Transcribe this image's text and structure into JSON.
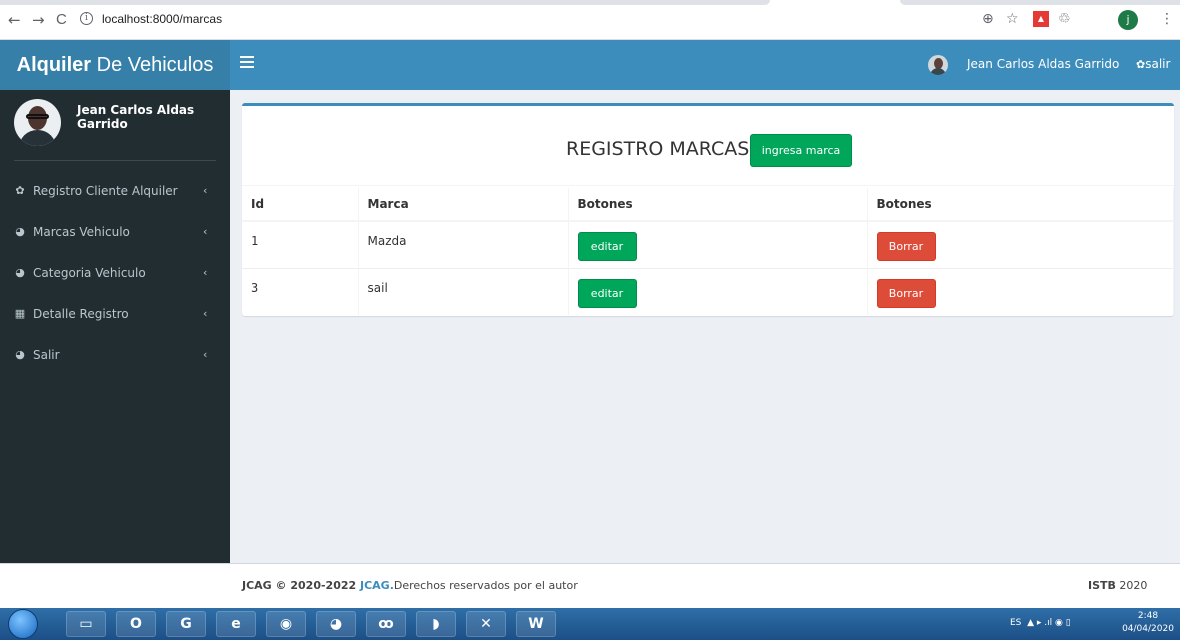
{
  "browser": {
    "url": "localhost:8000/marcas",
    "back_icon": "←",
    "forward_icon": "→",
    "reload_icon": "C",
    "info_icon": "i",
    "zoom_icon": "⊕",
    "star_icon": "☆",
    "ext_icon": "▲",
    "ext2_icon": "♲",
    "profile_initial": "j",
    "menu_icon": "⋮"
  },
  "header": {
    "logo_bold": "Alquiler",
    "logo_rest": " De Vehiculos",
    "user_name": "Jean Carlos Aldas Garrido",
    "logout_label": "salir",
    "logout_icon": "✿"
  },
  "sidebar": {
    "user_name": "Jean Carlos Aldas Garrido",
    "items": [
      {
        "icon": "✿",
        "label": "Registro Cliente Alquiler",
        "chevron": "‹"
      },
      {
        "icon": "◕",
        "label": "Marcas Vehiculo",
        "chevron": "‹"
      },
      {
        "icon": "◕",
        "label": "Categoria Vehiculo",
        "chevron": "‹"
      },
      {
        "icon": "▦",
        "label": "Detalle Registro",
        "chevron": "‹"
      },
      {
        "icon": "◕",
        "label": "Salir",
        "chevron": "‹"
      }
    ]
  },
  "main": {
    "title": "REGISTRO MARCAS",
    "add_button": "ingresa marca",
    "columns": [
      "Id",
      "Marca",
      "Botones",
      "Botones"
    ],
    "rows": [
      {
        "id": "1",
        "marca": "Mazda",
        "edit": "editar",
        "delete": "Borrar"
      },
      {
        "id": "3",
        "marca": "sail",
        "edit": "editar",
        "delete": "Borrar"
      }
    ]
  },
  "footer": {
    "left_prefix": "JCAG © 2020-2022 ",
    "left_link": "JCAG.",
    "left_suffix": "Derechos reservados por el autor",
    "right_bold": "ISTB",
    "right_rest": " 2020"
  },
  "taskbar": {
    "lang": "ES",
    "tray_icons": "▲ ▸ .ıl ◉ ▯",
    "time": "2:48",
    "date": "04/04/2020",
    "apps": [
      "▭",
      "O",
      "G",
      "e",
      "◉",
      "◕",
      "ꝏ",
      "◗",
      "✕",
      "W"
    ]
  },
  "colors": {
    "brand_dark": "#367fa9",
    "brand": "#3c8dbc",
    "sidebar_bg": "#222d32",
    "success": "#00a65a",
    "danger": "#dd4b39",
    "content_bg": "#ecf0f5"
  }
}
